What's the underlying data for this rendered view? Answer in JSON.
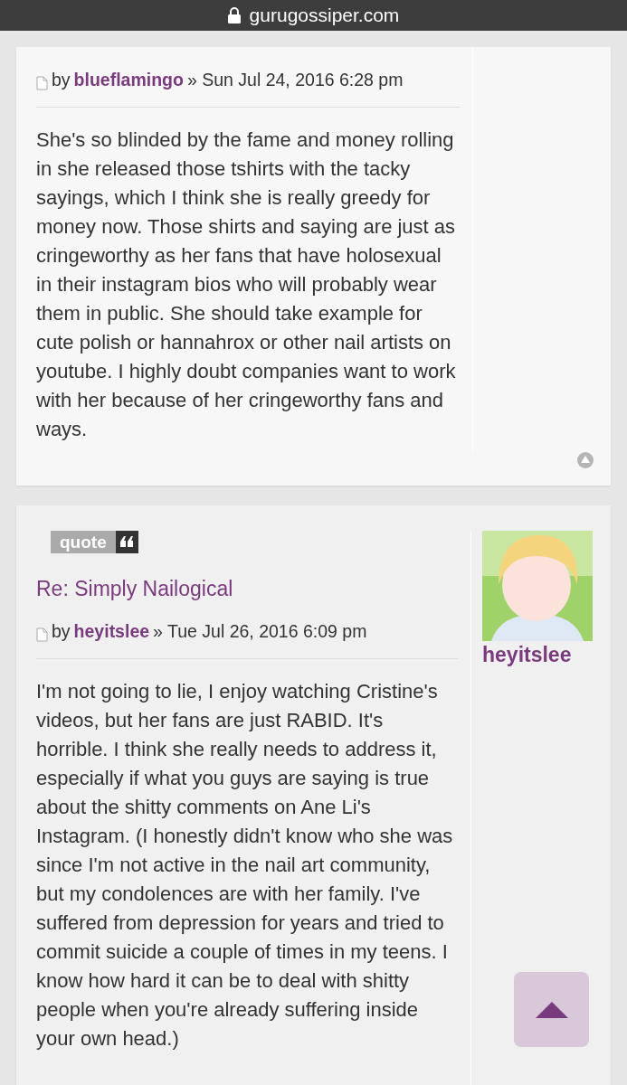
{
  "address_bar": {
    "url": "gurugossiper.com"
  },
  "posts": [
    {
      "by_label": "by",
      "author": "blueflamingo",
      "date": "» Sun Jul 24, 2016 6:28 pm",
      "body": "She's so blinded by the fame and money rolling in she released those tshirts with the tacky sayings, which I think she is really greedy for money now. Those shirts and saying are just as cringeworthy as her fans that have holosexual in their instagram bios who will probably wear them in public. She should take example for cute polish or hannahrox or other nail artists on youtube. I highly doubt companies want to work with her because of her cringeworthy fans and ways.",
      "top_link": true
    },
    {
      "quote_button": "quote",
      "title": "Re: Simply Nailogical",
      "by_label": "by",
      "author": "heyitslee",
      "date": "» Tue Jul 26, 2016 6:09 pm",
      "username": "heyitslee",
      "body": "I'm not going to lie, I enjoy watching Cristine's videos, but her fans are just RABID. It's horrible. I think she really needs to address it, especially if what you guys are saying is true about the shitty comments on Ane Li's Instagram. (I honestly didn't know who she was since I'm not active in the nail art community, but my condolences are with her family. I've suffered from depression for years and tried to commit suicide a couple of times in my teens. I know how hard it can be to deal with shitty people when you're already suffering inside your own head.)"
    }
  ]
}
